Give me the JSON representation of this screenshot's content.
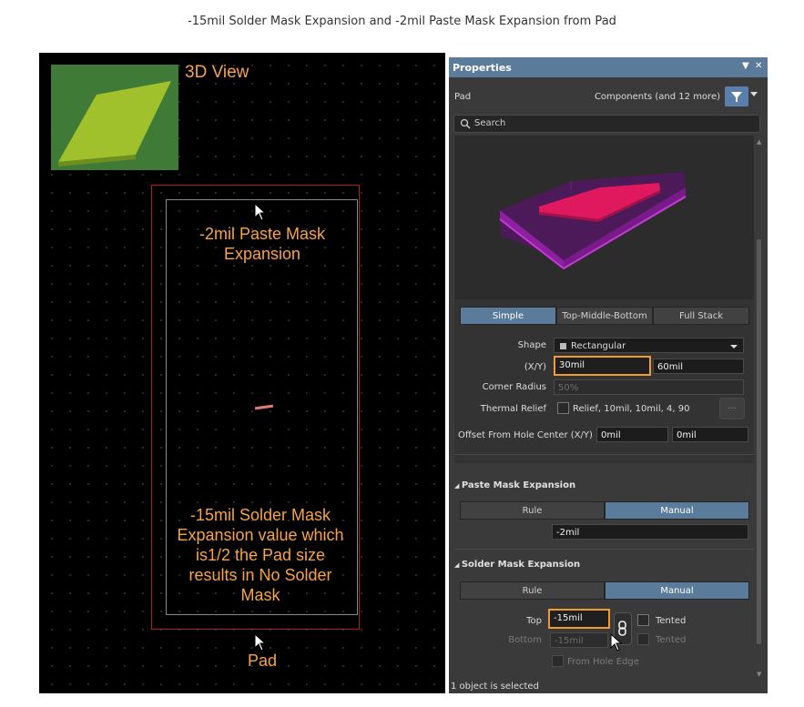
{
  "caption": "-15mil Solder Mask Expansion and -2mil Paste Mask Expansion from Pad",
  "canvas": {
    "view_title": "3D View",
    "paste_label": "-2mil Paste Mask Expansion",
    "solder_label": "-15mil Solder Mask Expansion value which is1/2 the Pad size results in No Solder Mask",
    "pad_label": "Pad"
  },
  "panel": {
    "title": "Properties",
    "object_type": "Pad",
    "filter_text": "Components (and 12 more)",
    "search_placeholder": "Search",
    "view_tabs": [
      "Simple",
      "Top-Middle-Bottom",
      "Full Stack"
    ],
    "active_view_tab": "Simple",
    "shape_label": "Shape",
    "shape_value": "Rectangular",
    "xy_label": "(X/Y)",
    "x_value": "30mil",
    "y_value": "60mil",
    "corner_radius_label": "Corner Radius",
    "corner_radius_value": "50%",
    "thermal_relief_label": "Thermal Relief",
    "thermal_relief_value": "Relief, 10mil, 10mil, 4, 90",
    "thermal_btn": "...",
    "offset_label": "Offset From Hole Center (X/Y)",
    "offset_x": "0mil",
    "offset_y": "0mil",
    "paste_section": "Paste Mask Expansion",
    "paste_modes": [
      "Rule",
      "Manual"
    ],
    "paste_value": "-2mil",
    "solder_section": "Solder Mask Expansion",
    "solder_modes": [
      "Rule",
      "Manual"
    ],
    "top_label": "Top",
    "top_value": "-15mil",
    "bottom_label": "Bottom",
    "bottom_value": "-15mil",
    "tented_label": "Tented",
    "from_hole_edge": "From Hole Edge",
    "status": "1 object is selected"
  },
  "colors": {
    "annotation": "#f7a34a",
    "panel_accent": "#5b7b9b",
    "highlight": "#f29b32"
  }
}
